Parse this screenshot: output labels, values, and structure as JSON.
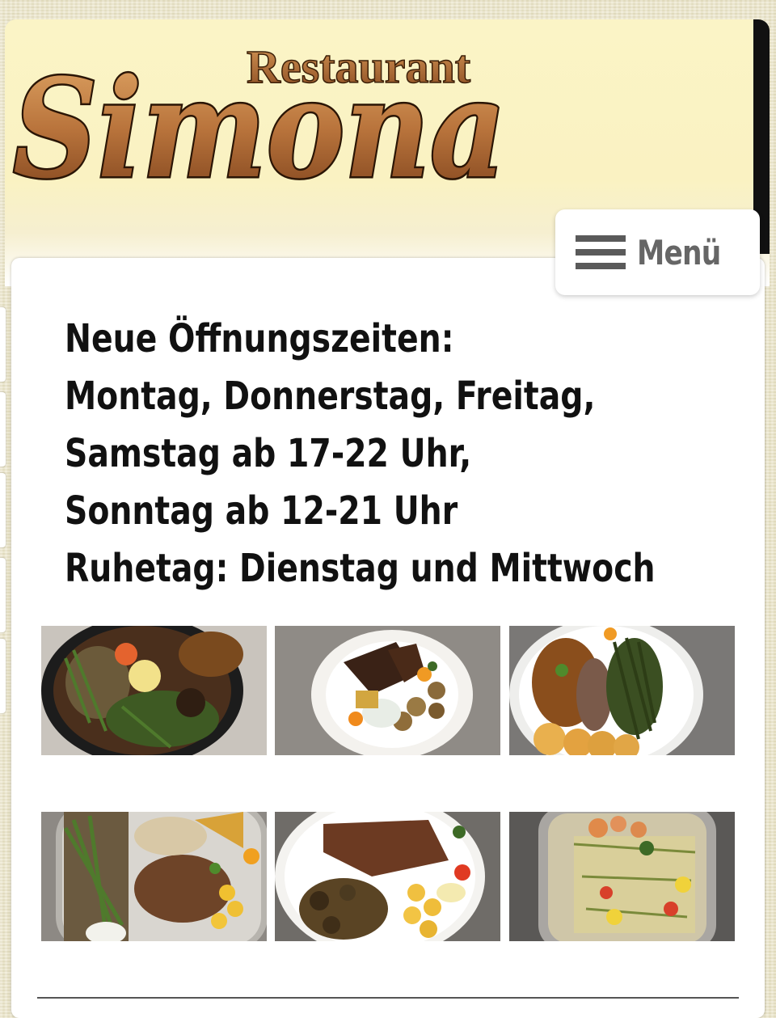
{
  "header": {
    "logo_small": "Restaurant",
    "logo_large": "Simona",
    "menu_label": "Menü"
  },
  "hours": {
    "lines": [
      "Neue Öffnungszeiten:",
      "Montag, Donnerstag, Freitag,",
      "Samstag ab 17-22 Uhr,",
      "Sonntag ab 12-21 Uhr",
      "Ruhetag: Dienstag und Mittwoch"
    ]
  },
  "gallery": {
    "images": [
      "dish-photo-1",
      "dish-photo-2",
      "dish-photo-3",
      "dish-photo-4",
      "dish-photo-5",
      "dish-photo-6"
    ]
  },
  "colors": {
    "header_bg": "#fbf4c6",
    "logo_gold": "#b8743a",
    "menu_text": "#666666",
    "text": "#111111"
  }
}
